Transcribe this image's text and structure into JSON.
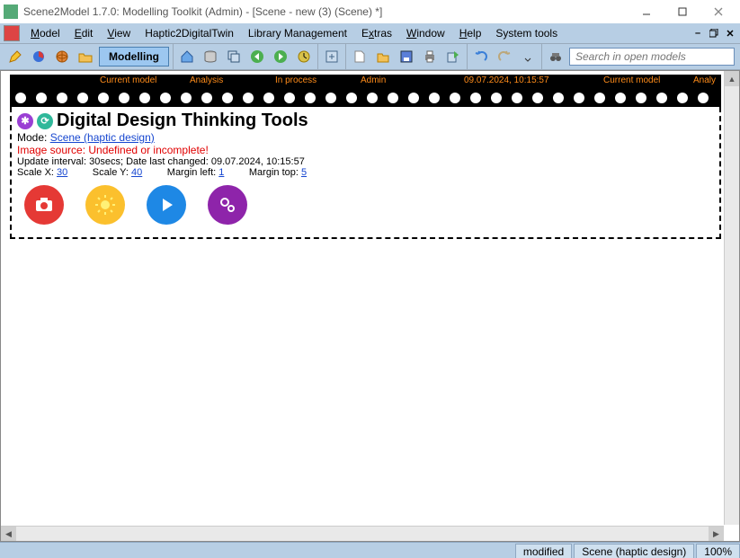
{
  "window": {
    "title": "Scene2Model 1.7.0: Modelling Toolkit (Admin) - [Scene - new (3) (Scene) *]"
  },
  "menu": {
    "model": "Model",
    "edit": "Edit",
    "view": "View",
    "haptic": "Haptic2DigitalTwin",
    "library": "Library Management",
    "extras": "Extras",
    "window": "Window",
    "help": "Help",
    "system": "System tools"
  },
  "toolbar": {
    "mode_label": "Modelling",
    "search_placeholder": "Search in open models"
  },
  "filmstrip": {
    "labels": [
      "Current model",
      "Analysis",
      "In process",
      "Admin",
      "09.07.2024, 10:15:57",
      "Current model",
      "Analy"
    ]
  },
  "doc": {
    "title": "Digital Design Thinking Tools",
    "mode_prefix": "Mode: ",
    "mode_link": "Scene (haptic design)",
    "error": "Image source: Undefined or incomplete!",
    "update_line": "Update interval: 30secs; Date last changed: 09.07.2024, 10:15:57",
    "scalex_label": "Scale X: ",
    "scalex_val": "30",
    "scaley_label": "Scale Y: ",
    "scaley_val": "40",
    "marginl_label": "Margin left: ",
    "marginl_val": "1",
    "margint_label": "Margin top: ",
    "margint_val": "5"
  },
  "status": {
    "modified": "modified",
    "scene": "Scene (haptic design)",
    "zoom": "100%"
  }
}
